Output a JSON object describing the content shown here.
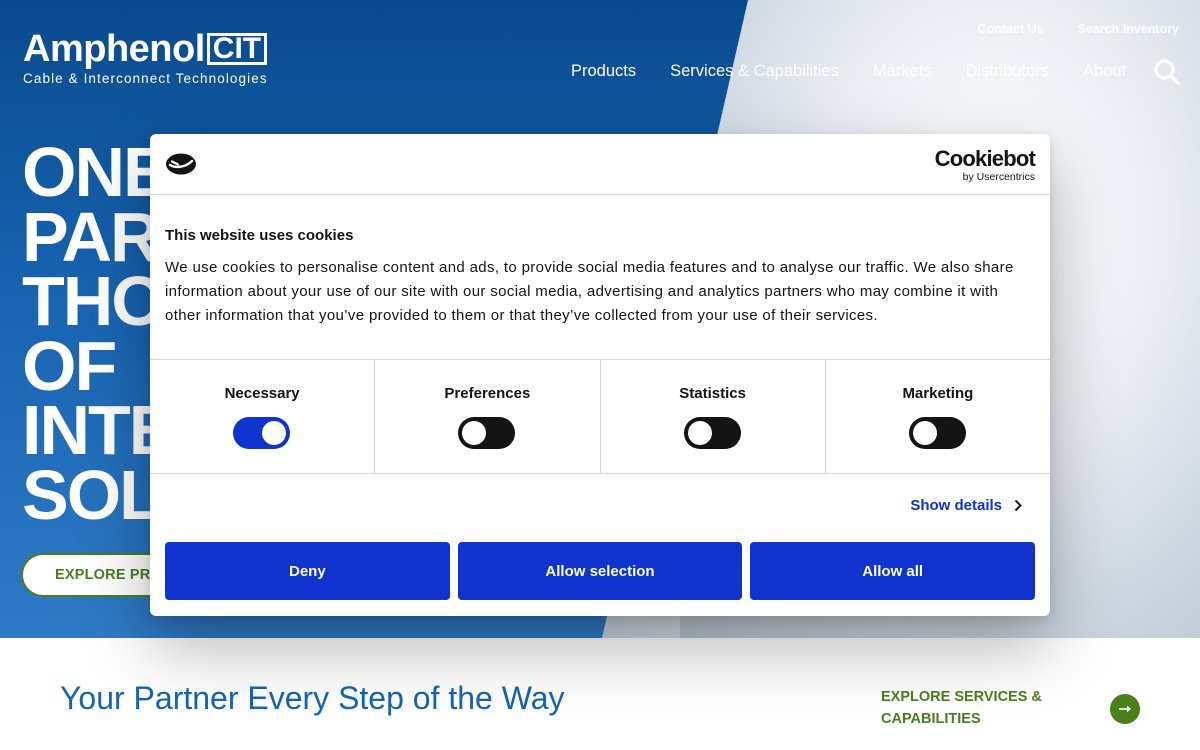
{
  "header": {
    "logo_main": "Amphenol",
    "logo_badge": "CIT",
    "logo_tagline": "Cable & Interconnect Technologies",
    "utility_links": [
      "Contact Us",
      "Search Inventory"
    ],
    "nav_items": [
      "Products",
      "Services & Capabilities",
      "Markets",
      "Distributors",
      "About"
    ],
    "search_icon": "search-icon"
  },
  "hero": {
    "title_lines": [
      "ONE",
      "PAR",
      "THO",
      "OF",
      "INTE",
      "SOL"
    ],
    "cta_label": "EXPLORE PRO"
  },
  "section": {
    "title": "Your Partner Every Step of the Way",
    "link_label": "EXPLORE SERVICES & CAPABILITIES",
    "link_icon": "arrow-right-icon"
  },
  "cookie_dialog": {
    "brand_main": "Cookiebot",
    "brand_sub": "by Usercentrics",
    "title": "This website uses cookies",
    "body": "We use cookies to personalise content and ads, to provide social media features and to analyse our traffic. We also share information about your use of our site with our social media, advertising and analytics partners who may combine it with other information that you’ve provided to them or that they’ve collected from your use of their services.",
    "toggles": [
      {
        "label": "Necessary",
        "on": true
      },
      {
        "label": "Preferences",
        "on": false
      },
      {
        "label": "Statistics",
        "on": false
      },
      {
        "label": "Marketing",
        "on": false
      }
    ],
    "show_details": "Show details",
    "buttons": {
      "deny": "Deny",
      "allow_selection": "Allow selection",
      "allow_all": "Allow all"
    }
  },
  "colors": {
    "hero_blue": "#1763b0",
    "accent_green": "#4b7f1c",
    "cookiebot_blue": "#1032cf",
    "title_blue": "#1565b2"
  }
}
